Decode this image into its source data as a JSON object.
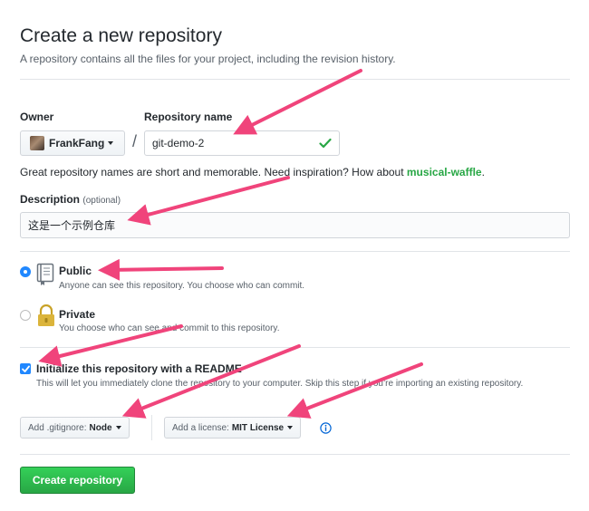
{
  "header": {
    "title": "Create a new repository",
    "subtitle": "A repository contains all the files for your project, including the revision history."
  },
  "owner": {
    "label": "Owner",
    "value": "FrankFang"
  },
  "repo": {
    "label": "Repository name",
    "value": "git-demo-2",
    "separator": "/"
  },
  "hint": {
    "text": "Great repository names are short and memorable. Need inspiration? How about ",
    "suggestion": "musical-waffle",
    "end": "."
  },
  "description": {
    "label": "Description",
    "optional": "(optional)",
    "value": "这是一个示例仓库"
  },
  "visibility": {
    "public_title": "Public",
    "public_desc": "Anyone can see this repository. You choose who can commit.",
    "private_title": "Private",
    "private_desc": "You choose who can see and commit to this repository.",
    "selected": "Public"
  },
  "init": {
    "title": "Initialize this repository with a README",
    "desc": "This will let you immediately clone the repository to your computer. Skip this step if you’re importing an existing repository.",
    "checked": true
  },
  "gitignore": {
    "prefix": "Add .gitignore:",
    "value": "Node"
  },
  "license": {
    "prefix": "Add a license:",
    "value": "MIT License"
  },
  "actions": {
    "create_label": "Create repository"
  },
  "colors": {
    "accent": "#2188ff",
    "success": "#28a745",
    "annotation_arrow": "#f0447b"
  },
  "icons": {
    "owner_avatar": "avatar",
    "repo_valid": "check-icon",
    "public": "repo-book-icon",
    "private": "lock-icon",
    "license_info": "info-icon"
  }
}
